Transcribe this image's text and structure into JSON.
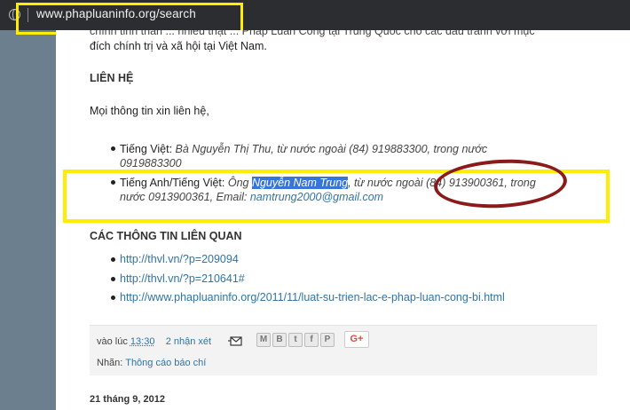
{
  "browser": {
    "url": "www.phapluaninfo.org/search"
  },
  "post": {
    "top_line_1": "chính tinh thần ... nhiều thật ... Pháp Luân Công tại Trung Quốc cho các đấu tranh với mục",
    "top_line_2": "đích chính trị và xã hội tại Việt Nam.",
    "contact_heading": "LIÊN HỆ",
    "contact_intro": "Mọi thông tin xin liên hệ,",
    "contact_items": [
      {
        "label": "Tiếng Việt: ",
        "value": "Bà Nguyễn Thị Thu, từ nước ngoài (84) 919883300, trong nước 0919883300"
      },
      {
        "label": "Tiếng Anh/Tiếng Việt: ",
        "prefix": "Ông ",
        "name": "Nguyễn Nam Trung",
        "rest": ", từ nước ngoài (84) 913900361, trong nước 0913900361, Email: ",
        "email": "namtrung2000@gmail.com"
      }
    ],
    "related_heading": "CÁC THÔNG TIN LIÊN QUAN",
    "related_links": [
      "http://thvl.vn/?p=209094",
      "http://thvl.vn/?p=210641#",
      "http://www.phapluaninfo.org/2011/11/luat-su-trien-lac-e-phap-luan-cong-bi.html"
    ]
  },
  "footer": {
    "posted_at_label": "vào lúc ",
    "posted_time": "13:30",
    "comments": "2 nhận xét",
    "share_buttons": [
      "M",
      "B",
      "t",
      "f",
      "P"
    ],
    "gplus_label": "G+",
    "labels_prefix": "Nhãn: ",
    "label_link": "Thông cáo báo chí"
  },
  "next_post_date": "21 tháng 9, 2012",
  "colors": {
    "annotation_highlight": "#ffee00",
    "annotation_circle": "#8b1a1a",
    "link": "#2f74a8",
    "selection": "#3875d7"
  }
}
